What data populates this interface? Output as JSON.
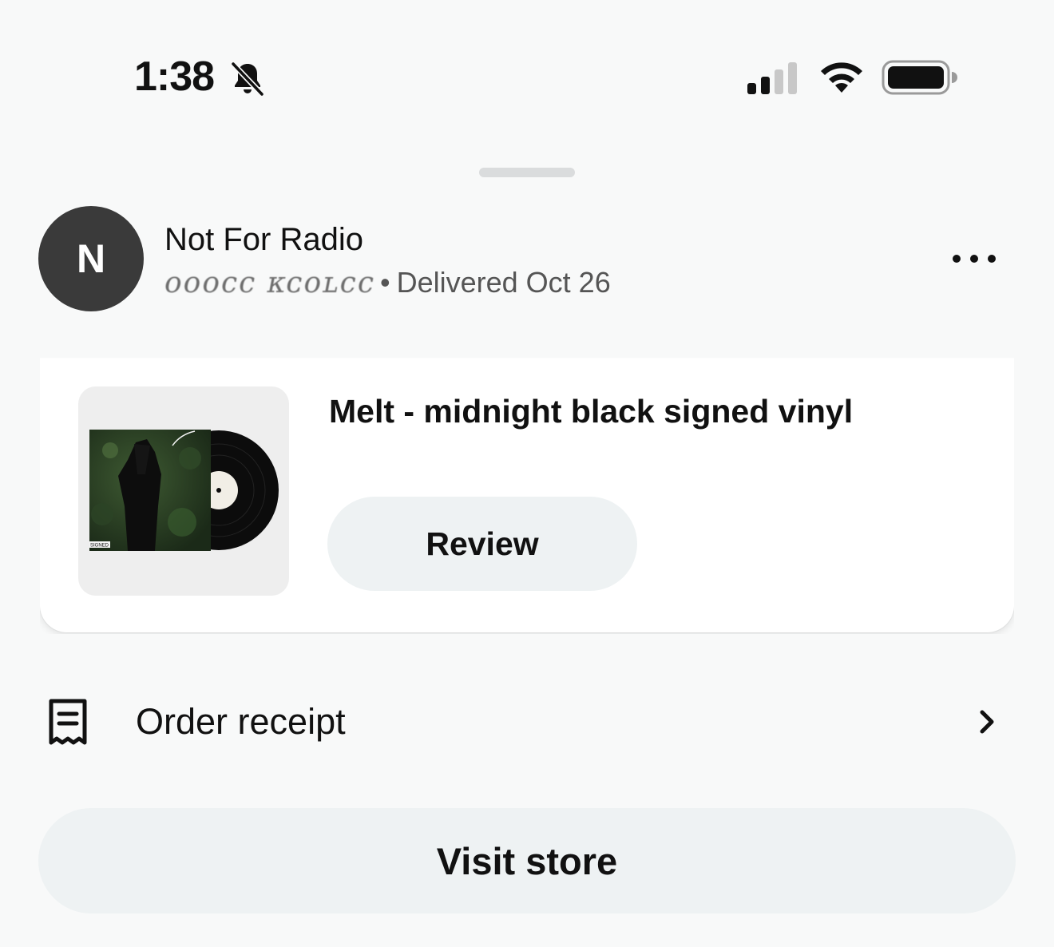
{
  "status_bar": {
    "time": "1:38",
    "mute_icon": "bell-slash-icon",
    "signal_icon": "cellular-signal-icon",
    "wifi_icon": "wifi-icon",
    "battery_icon": "battery-icon"
  },
  "store": {
    "avatar_initial": "N",
    "name": "Not For Radio",
    "masked_customer": "ooocc ᴋᴄoʟcc",
    "separator": "•",
    "delivery_status": "Delivered Oct 26",
    "more_icon": "more-horizontal-icon"
  },
  "product": {
    "title": "Melt - midnight black signed vinyl",
    "review_label": "Review",
    "thumbnail_badge": "SIGNED"
  },
  "receipt": {
    "label": "Order receipt",
    "icon": "receipt-icon",
    "chevron_icon": "chevron-right-icon"
  },
  "actions": {
    "visit_store_label": "Visit store"
  }
}
